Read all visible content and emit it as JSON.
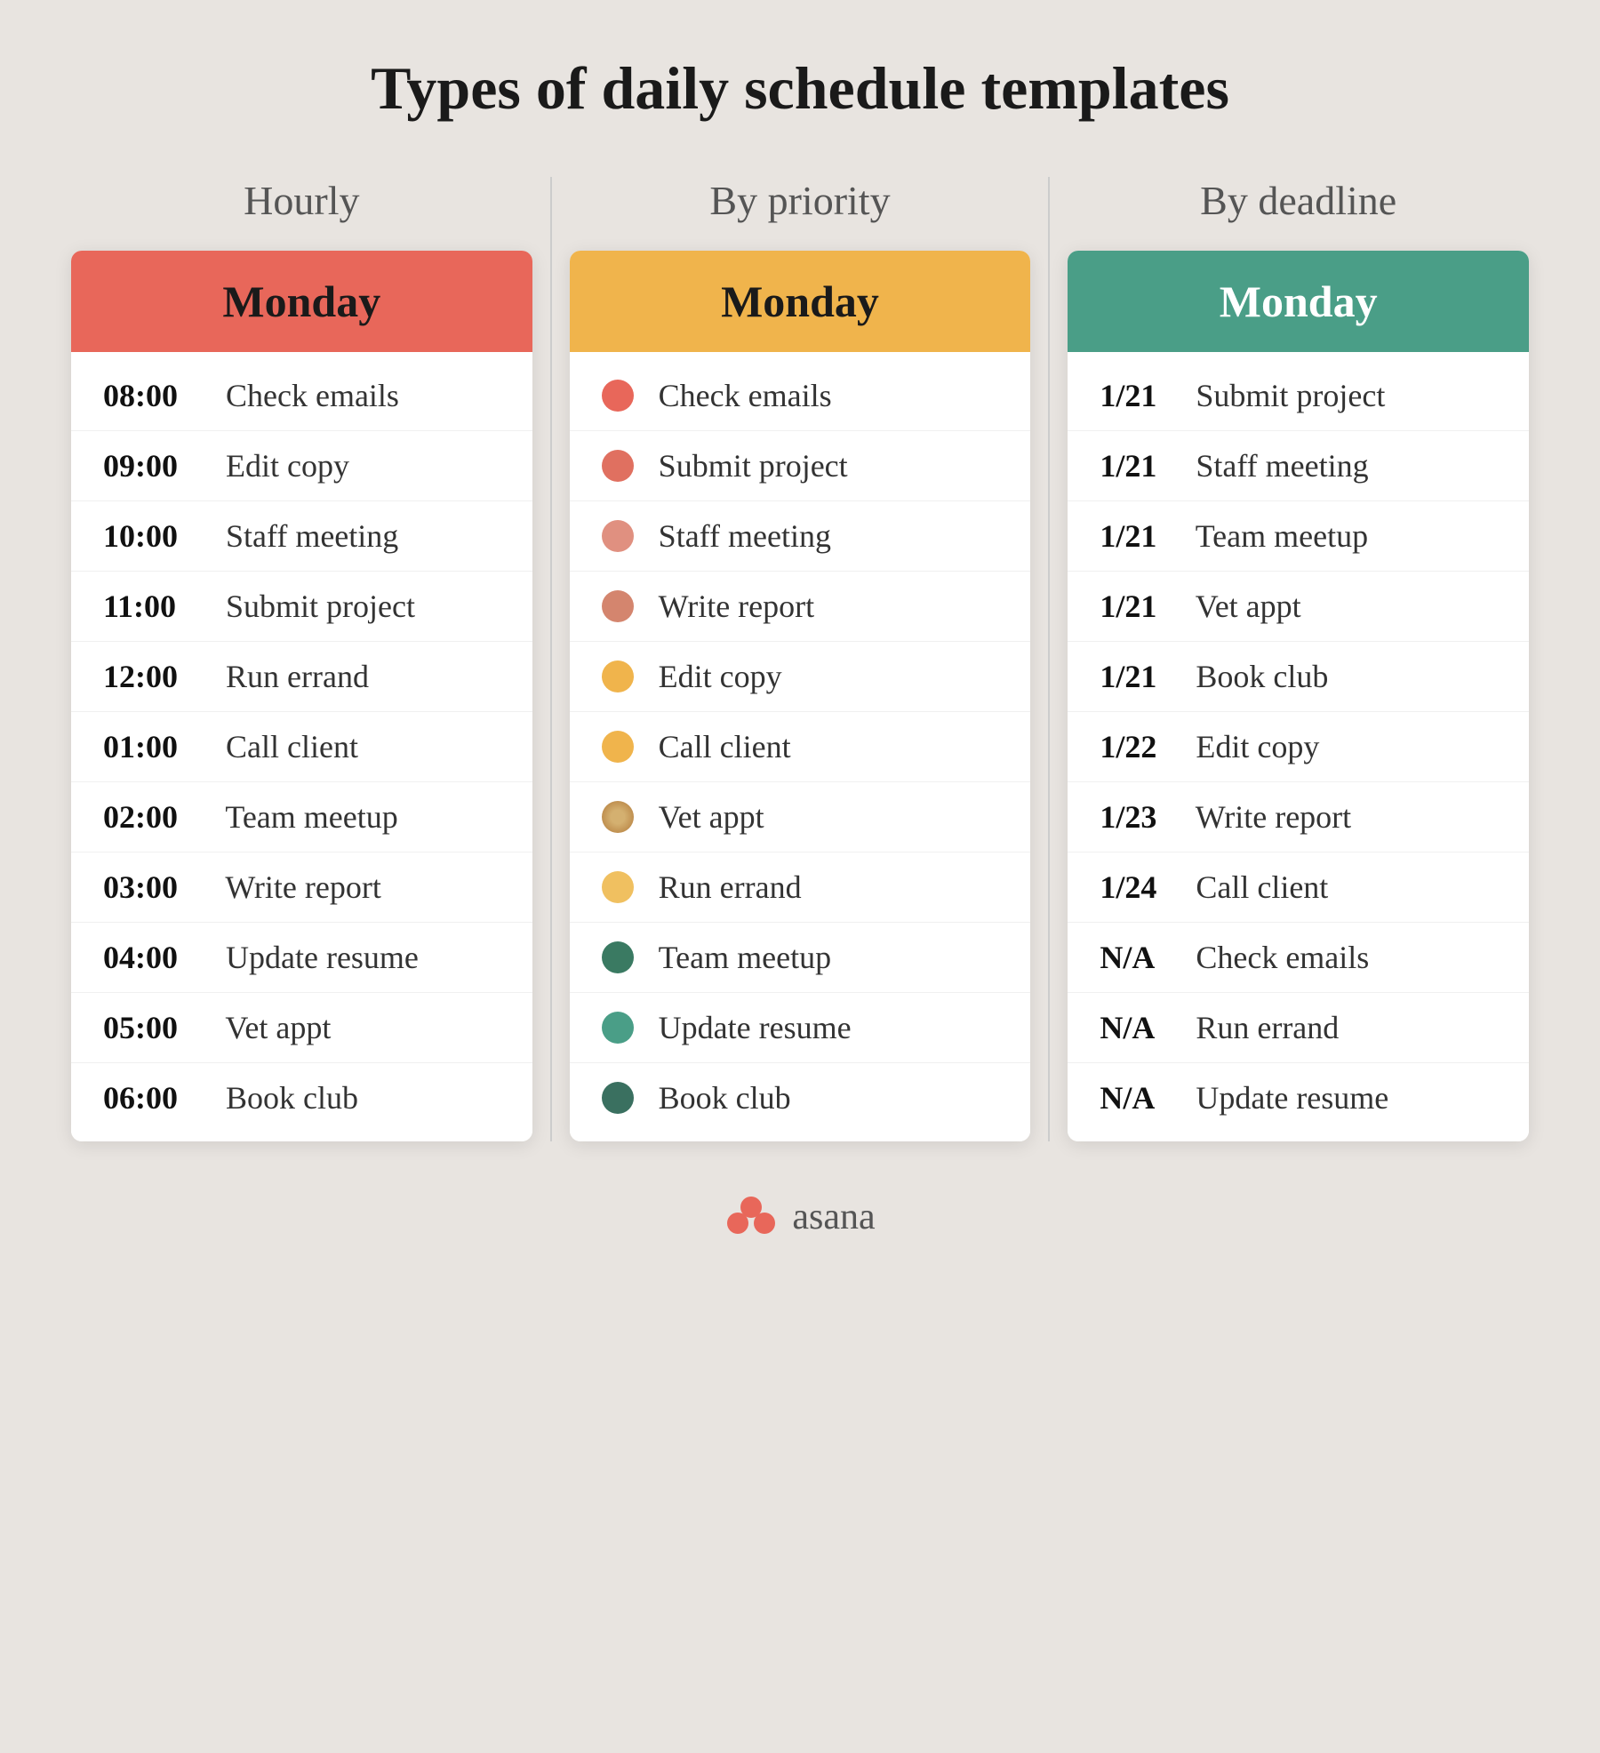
{
  "page": {
    "title": "Types of daily schedule templates",
    "background": "#e8e4e0"
  },
  "columns": [
    {
      "id": "hourly",
      "header_label": "Hourly",
      "card_header": "Monday",
      "card_header_style": "red",
      "rows": [
        {
          "time": "08:00",
          "task": "Check emails"
        },
        {
          "time": "09:00",
          "task": "Edit copy"
        },
        {
          "time": "10:00",
          "task": "Staff meeting"
        },
        {
          "time": "11:00",
          "task": "Submit project"
        },
        {
          "time": "12:00",
          "task": "Run errand"
        },
        {
          "time": "01:00",
          "task": "Call client"
        },
        {
          "time": "02:00",
          "task": "Team meetup"
        },
        {
          "time": "03:00",
          "task": "Write report"
        },
        {
          "time": "04:00",
          "task": "Update resume"
        },
        {
          "time": "05:00",
          "task": "Vet appt"
        },
        {
          "time": "06:00",
          "task": "Book club"
        }
      ]
    },
    {
      "id": "priority",
      "header_label": "By priority",
      "card_header": "Monday",
      "card_header_style": "orange",
      "rows": [
        {
          "dot_class": "dot-red-bright",
          "task": "Check emails"
        },
        {
          "dot_class": "dot-red-medium",
          "task": "Submit project"
        },
        {
          "dot_class": "dot-red-faded",
          "task": "Staff meeting"
        },
        {
          "dot_class": "dot-red-muted",
          "task": "Write report"
        },
        {
          "dot_class": "dot-orange-bright",
          "task": "Edit copy"
        },
        {
          "dot_class": "dot-orange-medium",
          "task": "Call client"
        },
        {
          "dot_class": "dot-tan",
          "task": "Vet appt"
        },
        {
          "dot_class": "dot-orange-light",
          "task": "Run errand"
        },
        {
          "dot_class": "dot-teal-dark",
          "task": "Team meetup"
        },
        {
          "dot_class": "dot-teal-medium",
          "task": "Update resume"
        },
        {
          "dot_class": "dot-teal-light",
          "task": "Book club"
        }
      ]
    },
    {
      "id": "deadline",
      "header_label": "By deadline",
      "card_header": "Monday",
      "card_header_style": "green",
      "rows": [
        {
          "date": "1/21",
          "task": "Submit project"
        },
        {
          "date": "1/21",
          "task": "Staff meeting"
        },
        {
          "date": "1/21",
          "task": "Team meetup"
        },
        {
          "date": "1/21",
          "task": "Vet appt"
        },
        {
          "date": "1/21",
          "task": "Book club"
        },
        {
          "date": "1/22",
          "task": "Edit copy"
        },
        {
          "date": "1/23",
          "task": "Write report"
        },
        {
          "date": "1/24",
          "task": "Call client"
        },
        {
          "date": "N/A",
          "task": "Check emails"
        },
        {
          "date": "N/A",
          "task": "Run errand"
        },
        {
          "date": "N/A",
          "task": "Update resume"
        }
      ]
    }
  ],
  "footer": {
    "brand_name": "asana"
  }
}
